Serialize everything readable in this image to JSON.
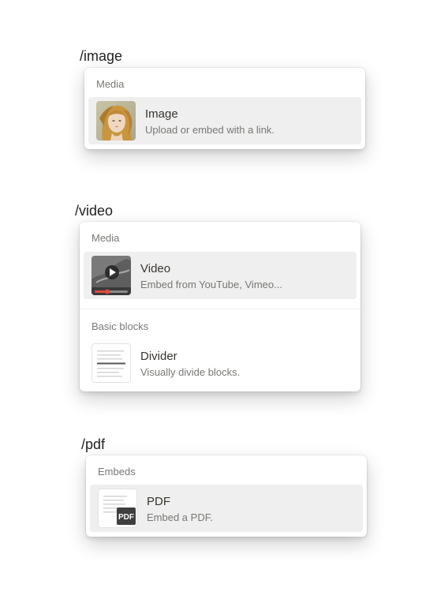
{
  "examples": [
    {
      "command": "/image",
      "sections": [
        {
          "label": "Media",
          "items": [
            {
              "title": "Image",
              "description": "Upload or embed with a link.",
              "icon": "image-thumbnail-icon"
            }
          ]
        }
      ]
    },
    {
      "command": "/video",
      "sections": [
        {
          "label": "Media",
          "items": [
            {
              "title": "Video",
              "description": "Embed from YouTube, Vimeo...",
              "icon": "video-thumbnail-icon"
            }
          ]
        },
        {
          "label": "Basic blocks",
          "items": [
            {
              "title": "Divider",
              "description": "Visually divide blocks.",
              "icon": "divider-thumbnail-icon"
            }
          ]
        }
      ]
    },
    {
      "command": "/pdf",
      "sections": [
        {
          "label": "Embeds",
          "items": [
            {
              "title": "PDF",
              "description": "Embed a PDF.",
              "icon": "pdf-thumbnail-icon",
              "badge": "PDF"
            }
          ]
        }
      ]
    }
  ],
  "colors": {
    "selected_bg": "#efefef",
    "muted_text": "#787774",
    "primary_text": "#37352f"
  }
}
